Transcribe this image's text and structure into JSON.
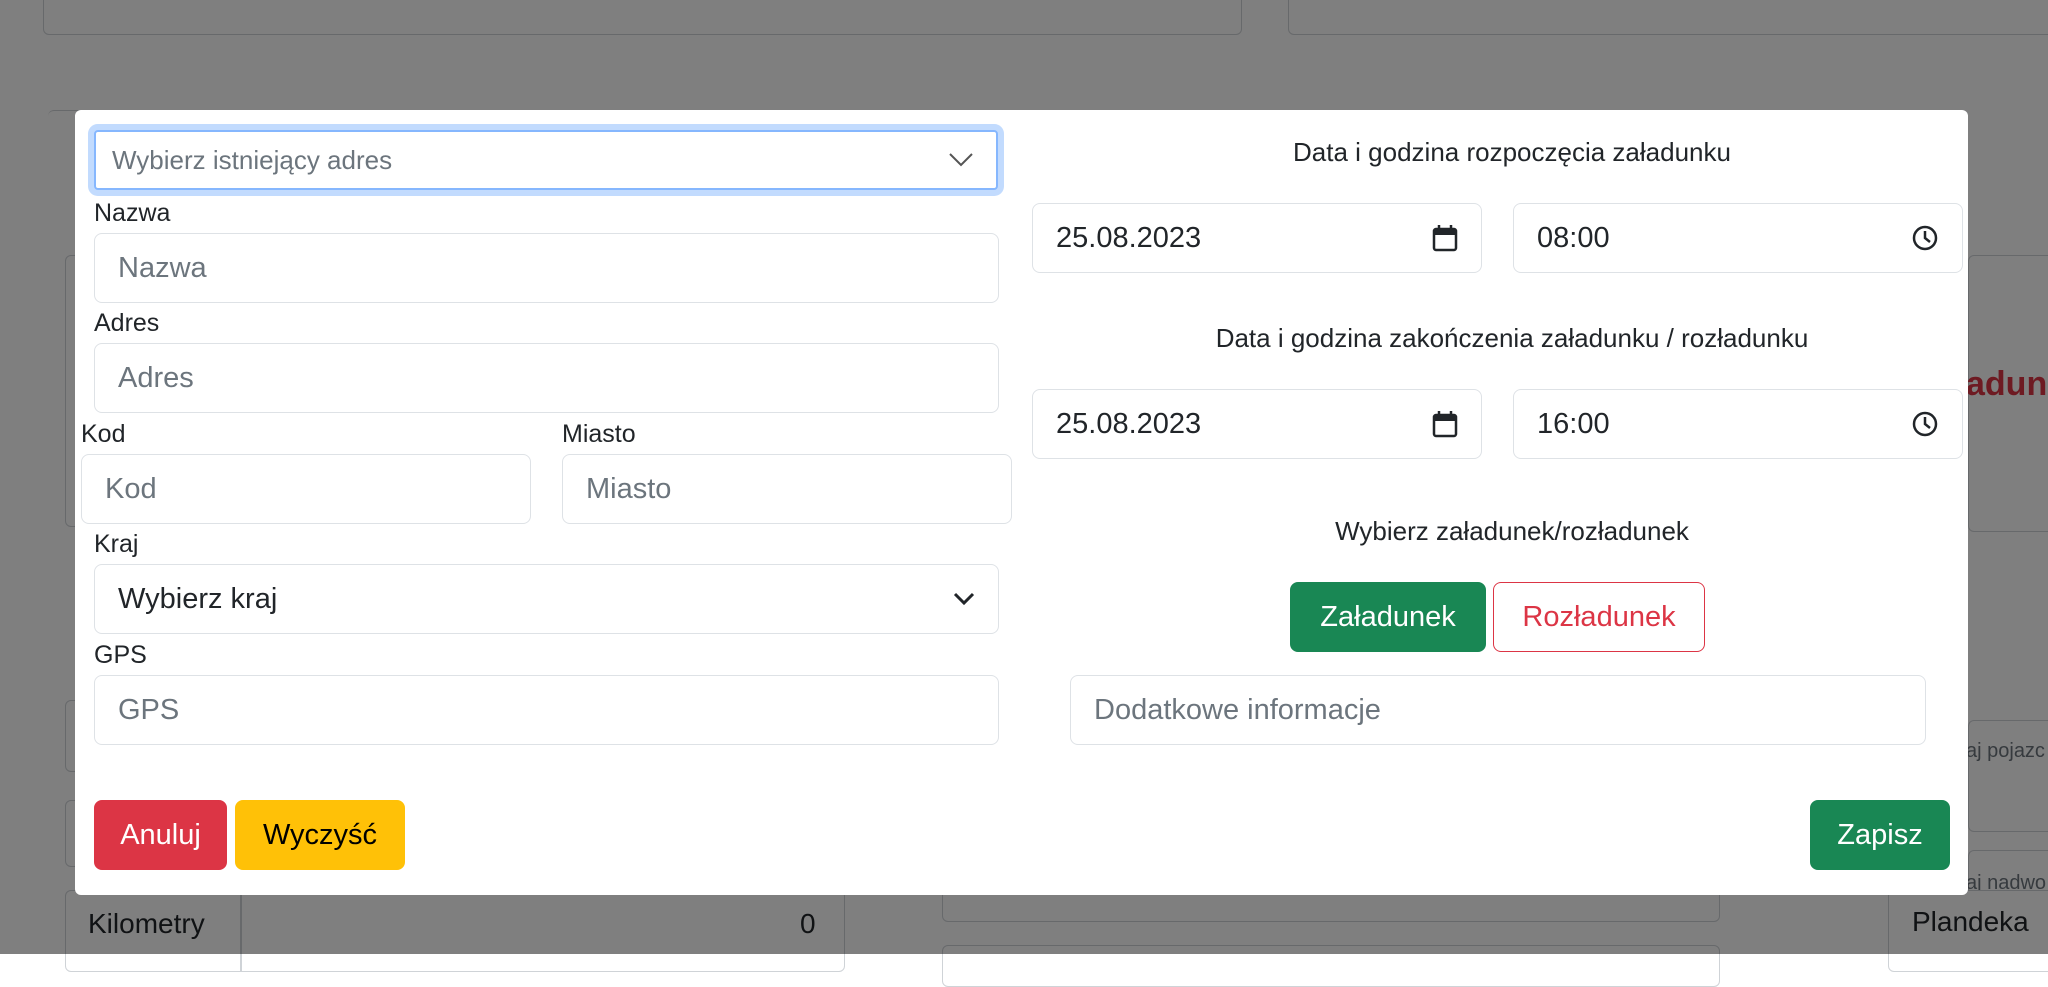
{
  "background": {
    "red_fragment": "adunk",
    "km_label": "Kilometry",
    "km_value": "0",
    "plandeka": "Plandeka",
    "hint_1": "aj pojazc",
    "hint_2": "aj nadwo"
  },
  "address_select": {
    "placeholder": "Wybierz istniejący adres"
  },
  "name": {
    "label": "Nazwa",
    "placeholder": "Nazwa"
  },
  "address": {
    "label": "Adres",
    "placeholder": "Adres"
  },
  "postal_code": {
    "label": "Kod",
    "placeholder": "Kod"
  },
  "city": {
    "label": "Miasto",
    "placeholder": "Miasto"
  },
  "country": {
    "label": "Kraj",
    "value": "Wybierz kraj"
  },
  "gps": {
    "label": "GPS",
    "placeholder": "GPS"
  },
  "start": {
    "heading": "Data i godzina rozpoczęcia załadunku",
    "date": "25.08.2023",
    "time": "08:00"
  },
  "end": {
    "heading": "Data i godzina zakończenia załadunku / rozładunku",
    "date": "25.08.2023",
    "time": "16:00"
  },
  "type": {
    "heading": "Wybierz załadunek/rozładunek",
    "loading_label": "Załadunek",
    "unloading_label": "Rozładunek"
  },
  "extra_info": {
    "placeholder": "Dodatkowe informacje"
  },
  "actions": {
    "cancel_label": "Anuluj",
    "clear_label": "Wyczyść",
    "save_label": "Zapisz"
  },
  "colors": {
    "success": "#198754",
    "danger": "#dc3545",
    "warning": "#ffc107",
    "focus_ring": "#86b7fe"
  }
}
